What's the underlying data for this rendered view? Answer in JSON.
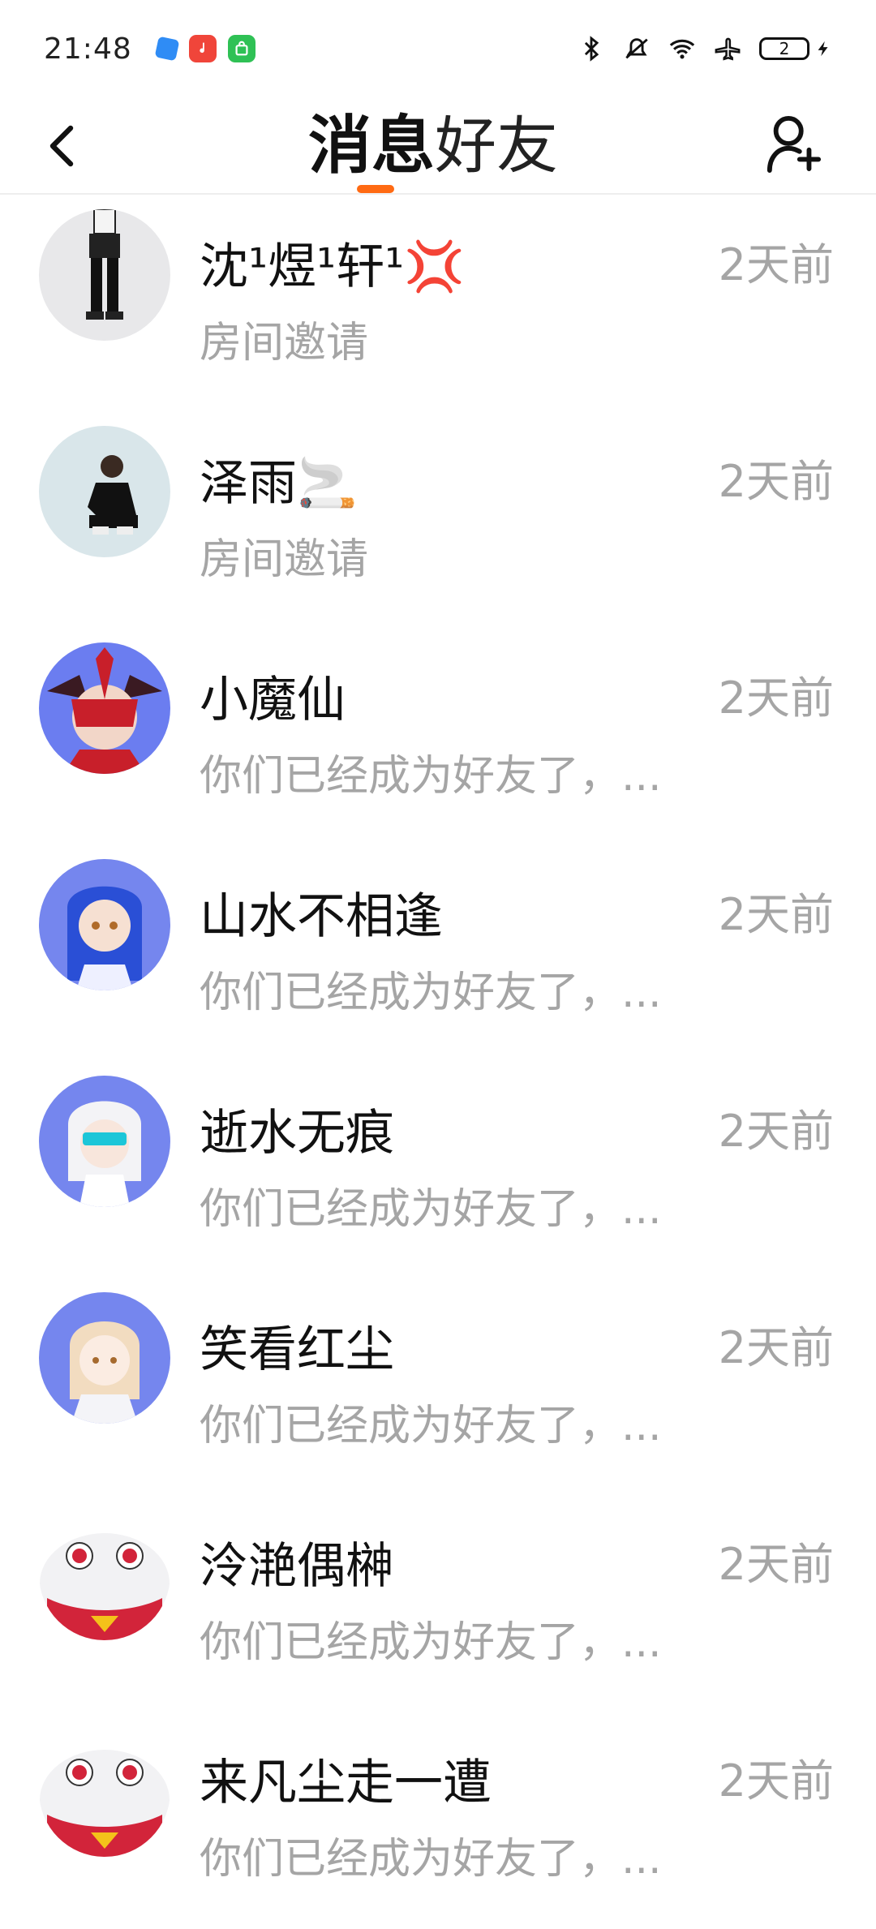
{
  "status_bar": {
    "time": "21:48",
    "battery": "2",
    "icons": [
      "bluetooth-icon",
      "mute-icon",
      "wifi-icon",
      "airplane-icon",
      "battery-icon",
      "charging-icon"
    ]
  },
  "header": {
    "tabs": [
      {
        "label": "消息",
        "active": true
      },
      {
        "label": "好友",
        "active": false
      }
    ],
    "accent_color": "#ff6a13"
  },
  "conversations": [
    {
      "name": "沈¹煜¹轩¹💢",
      "preview": "房间邀请",
      "time": "2天前",
      "avatar": "avatar-figure-standing"
    },
    {
      "name": "泽雨🚬",
      "preview": "房间邀请",
      "time": "2天前",
      "avatar": "avatar-figure-crouching"
    },
    {
      "name": "小魔仙",
      "preview": "你们已经成为好友了，...",
      "time": "2天前",
      "avatar": "avatar-red-mask"
    },
    {
      "name": "山水不相逢",
      "preview": "你们已经成为好友了，...",
      "time": "2天前",
      "avatar": "avatar-blue-hair"
    },
    {
      "name": "逝水无痕",
      "preview": "你们已经成为好友了，...",
      "time": "2天前",
      "avatar": "avatar-white-hair-visor"
    },
    {
      "name": "笑看红尘",
      "preview": "你们已经成为好友了，...",
      "time": "2天前",
      "avatar": "avatar-blonde"
    },
    {
      "name": "泠滟偶榊",
      "preview": "你们已经成为好友了，...",
      "time": "2天前",
      "avatar": "avatar-clown"
    },
    {
      "name": "来凡尘走一遭",
      "preview": "你们已经成为好友了，...",
      "time": "2天前",
      "avatar": "avatar-clown"
    }
  ]
}
